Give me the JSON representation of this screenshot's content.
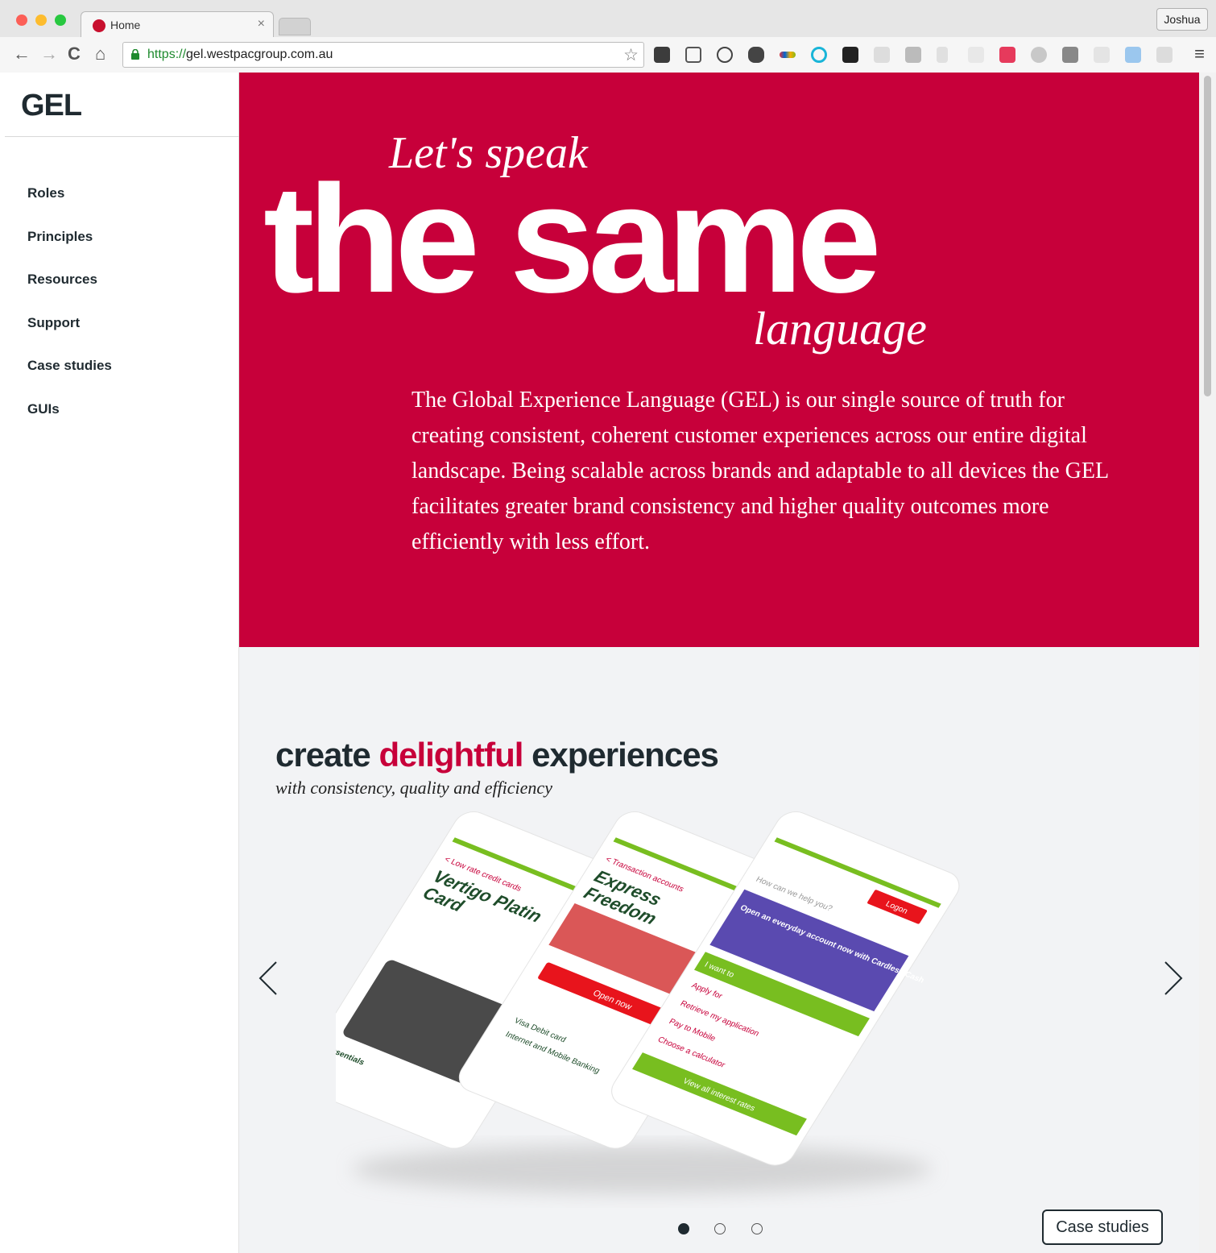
{
  "browser": {
    "tab_title": "Home",
    "tab_close": "×",
    "profile_name": "Joshua",
    "url_scheme": "https://",
    "url_host": "gel.westpacgroup.com.au",
    "back_glyph": "←",
    "forward_glyph": "→",
    "reload_glyph": "C",
    "home_glyph": "⌂",
    "bookmark_glyph": "☆",
    "menu_glyph": "≡"
  },
  "sidebar": {
    "logo": "GEL",
    "items": [
      {
        "label": "Roles"
      },
      {
        "label": "Principles"
      },
      {
        "label": "Resources"
      },
      {
        "label": "Support"
      },
      {
        "label": "Case studies"
      },
      {
        "label": "GUIs"
      }
    ]
  },
  "hero": {
    "lets_speak": "Let's speak",
    "the_same": "the same",
    "language": "language",
    "intro": "The Global Experience Language (GEL) is our single source of truth for creating consistent, coherent customer experiences across our entire digital landscape. Being scalable across brands and adaptable to all devices the GEL facilitates greater brand consistency and higher quality outcomes more efficiently with less effort."
  },
  "feature": {
    "headline_pre": "create ",
    "headline_accent": "delightful",
    "headline_post": " experiences",
    "subline": "with consistency, quality and efficiency",
    "case_studies_button": "Case studies",
    "current_slide": 1,
    "total_slides": 3,
    "phones": [
      {
        "title_line1": "Vertigo Platin",
        "title_line2": "Card",
        "crumb": "< Low rate credit cards",
        "badge": "Essentials"
      },
      {
        "title_line1": "Express",
        "title_line2": "Freedom",
        "crumb": "< Transaction accounts",
        "cta": "Open now",
        "bullet1": "Visa Debit card",
        "bullet2": "Internet and Mobile Banking"
      },
      {
        "search": "How can we help you?",
        "logon": "Logon",
        "promo": "Open an everyday account now with Cardless Cash",
        "menu1": "I want to",
        "menu2": "Apply for",
        "menu3": "Retrieve my application",
        "menu4": "Pay to Mobile",
        "menu5": "Choose a calculator",
        "cta": "View all interest rates"
      }
    ]
  },
  "colors": {
    "brand_red": "#c7003a",
    "text_dark": "#1f2a30",
    "phone_green": "#78be20"
  }
}
